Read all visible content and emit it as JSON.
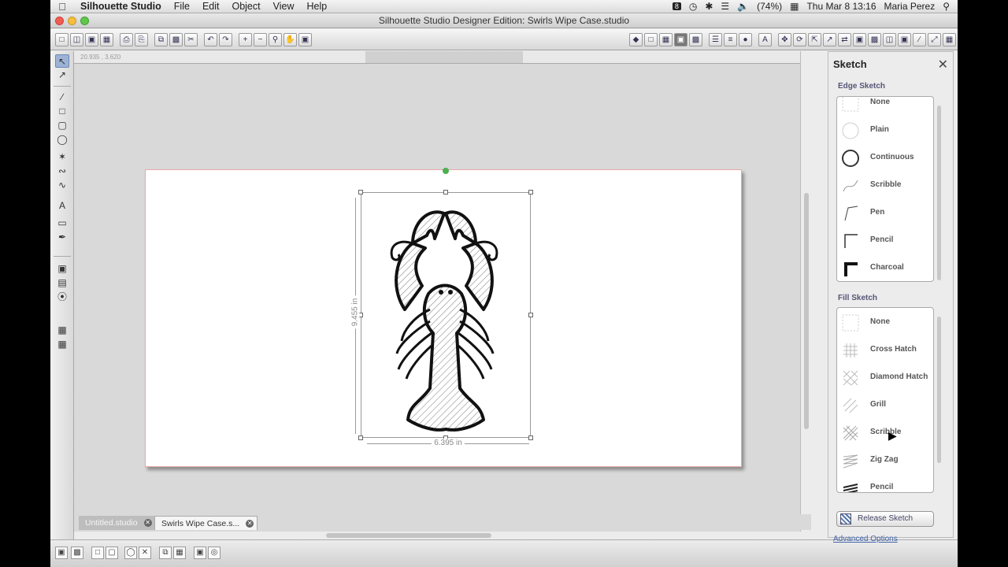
{
  "menubar": {
    "app_name": "Silhouette Studio",
    "menus": [
      "File",
      "Edit",
      "Object",
      "View",
      "Help"
    ],
    "notif_badge": "8",
    "battery": "(74%)",
    "datetime": "Thu Mar 8  13:16",
    "user": "Maria Perez"
  },
  "window": {
    "title": "Silhouette Studio Designer Edition: Swirls Wipe Case.studio"
  },
  "ruler": {
    "coord": "20.935 , 3.620"
  },
  "canvas": {
    "width_label": "6.395 in",
    "height_label": "9.455 in"
  },
  "tabs": {
    "tab1": "Untitled.studio",
    "tab2": "Swirls Wipe Case.s..."
  },
  "panel": {
    "title": "Sketch",
    "edge_label": "Edge Sketch",
    "edge_items": [
      "None",
      "Plain",
      "Continuous",
      "Scribble",
      "Pen",
      "Pencil",
      "Charcoal"
    ],
    "fill_label": "Fill Sketch",
    "fill_items": [
      "None",
      "Cross Hatch",
      "Diamond Hatch",
      "Grill",
      "Scribble",
      "Zig Zag",
      "Pencil"
    ],
    "release_label": "Release Sketch",
    "advanced_label": "Advanced Options"
  }
}
